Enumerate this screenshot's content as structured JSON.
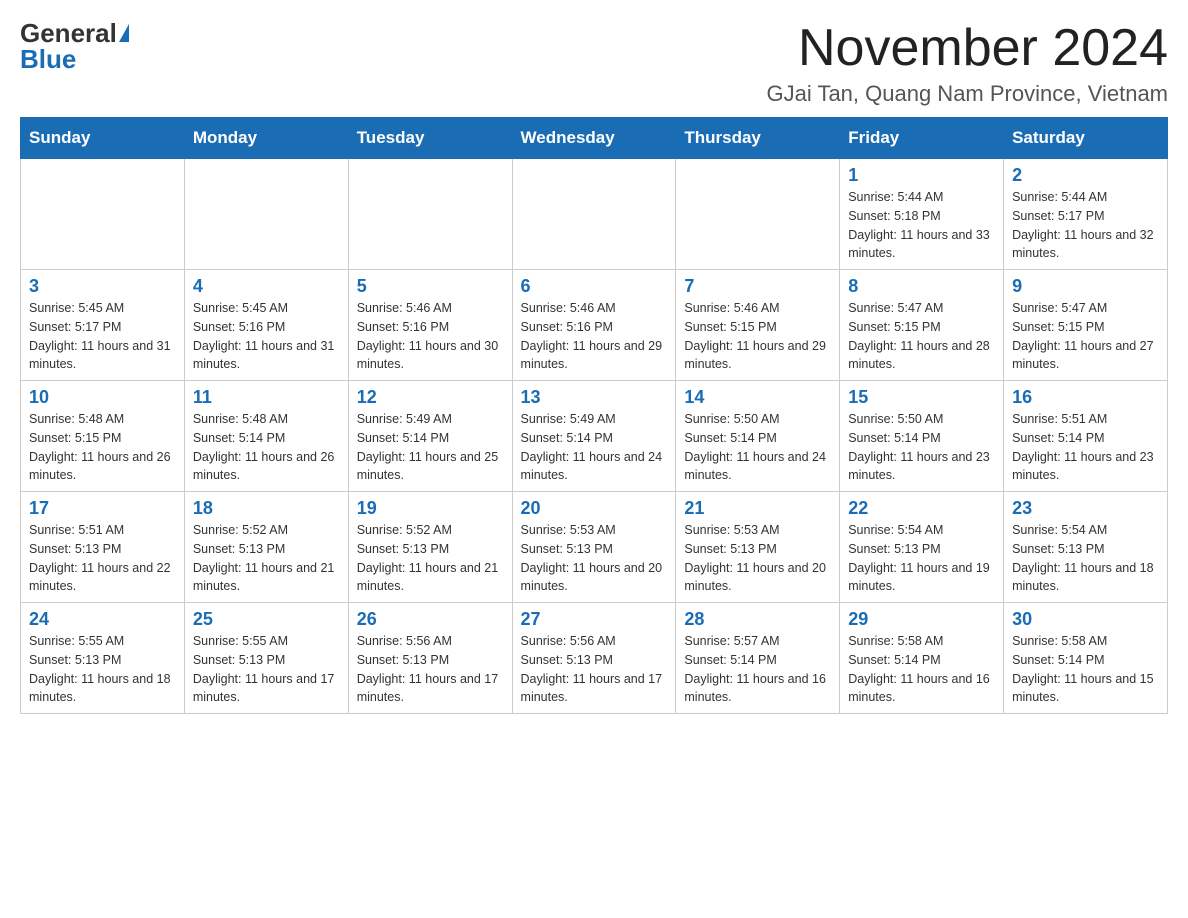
{
  "header": {
    "logo_general": "General",
    "logo_blue": "Blue",
    "title": "November 2024",
    "subtitle": "GJai Tan, Quang Nam Province, Vietnam"
  },
  "weekdays": [
    "Sunday",
    "Monday",
    "Tuesday",
    "Wednesday",
    "Thursday",
    "Friday",
    "Saturday"
  ],
  "weeks": [
    [
      {
        "day": "",
        "sunrise": "",
        "sunset": "",
        "daylight": ""
      },
      {
        "day": "",
        "sunrise": "",
        "sunset": "",
        "daylight": ""
      },
      {
        "day": "",
        "sunrise": "",
        "sunset": "",
        "daylight": ""
      },
      {
        "day": "",
        "sunrise": "",
        "sunset": "",
        "daylight": ""
      },
      {
        "day": "",
        "sunrise": "",
        "sunset": "",
        "daylight": ""
      },
      {
        "day": "1",
        "sunrise": "Sunrise: 5:44 AM",
        "sunset": "Sunset: 5:18 PM",
        "daylight": "Daylight: 11 hours and 33 minutes."
      },
      {
        "day": "2",
        "sunrise": "Sunrise: 5:44 AM",
        "sunset": "Sunset: 5:17 PM",
        "daylight": "Daylight: 11 hours and 32 minutes."
      }
    ],
    [
      {
        "day": "3",
        "sunrise": "Sunrise: 5:45 AM",
        "sunset": "Sunset: 5:17 PM",
        "daylight": "Daylight: 11 hours and 31 minutes."
      },
      {
        "day": "4",
        "sunrise": "Sunrise: 5:45 AM",
        "sunset": "Sunset: 5:16 PM",
        "daylight": "Daylight: 11 hours and 31 minutes."
      },
      {
        "day": "5",
        "sunrise": "Sunrise: 5:46 AM",
        "sunset": "Sunset: 5:16 PM",
        "daylight": "Daylight: 11 hours and 30 minutes."
      },
      {
        "day": "6",
        "sunrise": "Sunrise: 5:46 AM",
        "sunset": "Sunset: 5:16 PM",
        "daylight": "Daylight: 11 hours and 29 minutes."
      },
      {
        "day": "7",
        "sunrise": "Sunrise: 5:46 AM",
        "sunset": "Sunset: 5:15 PM",
        "daylight": "Daylight: 11 hours and 29 minutes."
      },
      {
        "day": "8",
        "sunrise": "Sunrise: 5:47 AM",
        "sunset": "Sunset: 5:15 PM",
        "daylight": "Daylight: 11 hours and 28 minutes."
      },
      {
        "day": "9",
        "sunrise": "Sunrise: 5:47 AM",
        "sunset": "Sunset: 5:15 PM",
        "daylight": "Daylight: 11 hours and 27 minutes."
      }
    ],
    [
      {
        "day": "10",
        "sunrise": "Sunrise: 5:48 AM",
        "sunset": "Sunset: 5:15 PM",
        "daylight": "Daylight: 11 hours and 26 minutes."
      },
      {
        "day": "11",
        "sunrise": "Sunrise: 5:48 AM",
        "sunset": "Sunset: 5:14 PM",
        "daylight": "Daylight: 11 hours and 26 minutes."
      },
      {
        "day": "12",
        "sunrise": "Sunrise: 5:49 AM",
        "sunset": "Sunset: 5:14 PM",
        "daylight": "Daylight: 11 hours and 25 minutes."
      },
      {
        "day": "13",
        "sunrise": "Sunrise: 5:49 AM",
        "sunset": "Sunset: 5:14 PM",
        "daylight": "Daylight: 11 hours and 24 minutes."
      },
      {
        "day": "14",
        "sunrise": "Sunrise: 5:50 AM",
        "sunset": "Sunset: 5:14 PM",
        "daylight": "Daylight: 11 hours and 24 minutes."
      },
      {
        "day": "15",
        "sunrise": "Sunrise: 5:50 AM",
        "sunset": "Sunset: 5:14 PM",
        "daylight": "Daylight: 11 hours and 23 minutes."
      },
      {
        "day": "16",
        "sunrise": "Sunrise: 5:51 AM",
        "sunset": "Sunset: 5:14 PM",
        "daylight": "Daylight: 11 hours and 23 minutes."
      }
    ],
    [
      {
        "day": "17",
        "sunrise": "Sunrise: 5:51 AM",
        "sunset": "Sunset: 5:13 PM",
        "daylight": "Daylight: 11 hours and 22 minutes."
      },
      {
        "day": "18",
        "sunrise": "Sunrise: 5:52 AM",
        "sunset": "Sunset: 5:13 PM",
        "daylight": "Daylight: 11 hours and 21 minutes."
      },
      {
        "day": "19",
        "sunrise": "Sunrise: 5:52 AM",
        "sunset": "Sunset: 5:13 PM",
        "daylight": "Daylight: 11 hours and 21 minutes."
      },
      {
        "day": "20",
        "sunrise": "Sunrise: 5:53 AM",
        "sunset": "Sunset: 5:13 PM",
        "daylight": "Daylight: 11 hours and 20 minutes."
      },
      {
        "day": "21",
        "sunrise": "Sunrise: 5:53 AM",
        "sunset": "Sunset: 5:13 PM",
        "daylight": "Daylight: 11 hours and 20 minutes."
      },
      {
        "day": "22",
        "sunrise": "Sunrise: 5:54 AM",
        "sunset": "Sunset: 5:13 PM",
        "daylight": "Daylight: 11 hours and 19 minutes."
      },
      {
        "day": "23",
        "sunrise": "Sunrise: 5:54 AM",
        "sunset": "Sunset: 5:13 PM",
        "daylight": "Daylight: 11 hours and 18 minutes."
      }
    ],
    [
      {
        "day": "24",
        "sunrise": "Sunrise: 5:55 AM",
        "sunset": "Sunset: 5:13 PM",
        "daylight": "Daylight: 11 hours and 18 minutes."
      },
      {
        "day": "25",
        "sunrise": "Sunrise: 5:55 AM",
        "sunset": "Sunset: 5:13 PM",
        "daylight": "Daylight: 11 hours and 17 minutes."
      },
      {
        "day": "26",
        "sunrise": "Sunrise: 5:56 AM",
        "sunset": "Sunset: 5:13 PM",
        "daylight": "Daylight: 11 hours and 17 minutes."
      },
      {
        "day": "27",
        "sunrise": "Sunrise: 5:56 AM",
        "sunset": "Sunset: 5:13 PM",
        "daylight": "Daylight: 11 hours and 17 minutes."
      },
      {
        "day": "28",
        "sunrise": "Sunrise: 5:57 AM",
        "sunset": "Sunset: 5:14 PM",
        "daylight": "Daylight: 11 hours and 16 minutes."
      },
      {
        "day": "29",
        "sunrise": "Sunrise: 5:58 AM",
        "sunset": "Sunset: 5:14 PM",
        "daylight": "Daylight: 11 hours and 16 minutes."
      },
      {
        "day": "30",
        "sunrise": "Sunrise: 5:58 AM",
        "sunset": "Sunset: 5:14 PM",
        "daylight": "Daylight: 11 hours and 15 minutes."
      }
    ]
  ]
}
